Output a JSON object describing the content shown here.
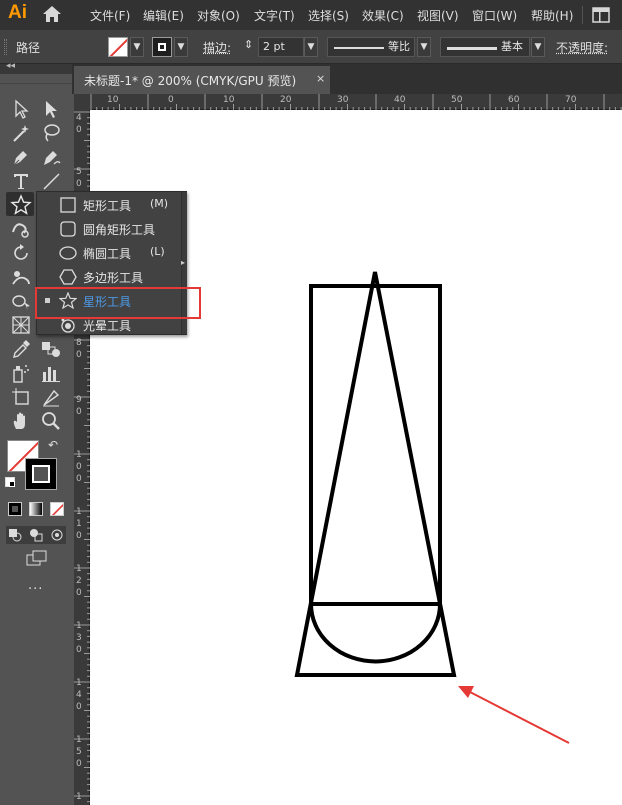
{
  "app": {
    "logo": "Ai"
  },
  "menu": [
    "文件(F)",
    "编辑(E)",
    "对象(O)",
    "文字(T)",
    "选择(S)",
    "效果(C)",
    "视图(V)",
    "窗口(W)",
    "帮助(H)"
  ],
  "control_bar": {
    "selection_label": "路径",
    "stroke_label": "描边:",
    "stroke_value": "2 pt",
    "profile_label": "等比",
    "brush_label": "基本",
    "opacity_label": "不透明度:"
  },
  "document_tab": {
    "title": "未标题-1* @ 200% (CMYK/GPU 预览)",
    "close": "×"
  },
  "ruler": {
    "top_labels": [
      "10",
      "0",
      "10",
      "20",
      "30",
      "40",
      "50",
      "60",
      "70"
    ],
    "left_labels": [
      "4",
      "0",
      "5",
      "0",
      "6",
      "0",
      "7",
      "0",
      "8",
      "0",
      "9",
      "0",
      "1",
      "0",
      "0",
      "1",
      "1",
      "0",
      "1",
      "2",
      "0",
      "1",
      "3",
      "0",
      "1",
      "4",
      "0",
      "1",
      "5",
      "0",
      "1",
      "6",
      "0"
    ]
  },
  "flyout": {
    "items": [
      {
        "label": "矩形工具",
        "shortcut": "(M)",
        "icon": "rectangle-icon",
        "selected": false
      },
      {
        "label": "圆角矩形工具",
        "shortcut": "",
        "icon": "rounded-rectangle-icon",
        "selected": false
      },
      {
        "label": "椭圆工具",
        "shortcut": "(L)",
        "icon": "ellipse-icon",
        "selected": false
      },
      {
        "label": "多边形工具",
        "shortcut": "",
        "icon": "polygon-icon",
        "selected": false
      },
      {
        "label": "星形工具",
        "shortcut": "",
        "icon": "star-icon",
        "selected": true
      },
      {
        "label": "光晕工具",
        "shortcut": "",
        "icon": "flare-icon",
        "selected": false
      }
    ]
  },
  "colors": {
    "accent_selected": "#4d9ae8",
    "highlight_box": "#e53935",
    "arrow": "#e53935",
    "logo": "#ff9a00"
  },
  "toolbar_more": "..."
}
